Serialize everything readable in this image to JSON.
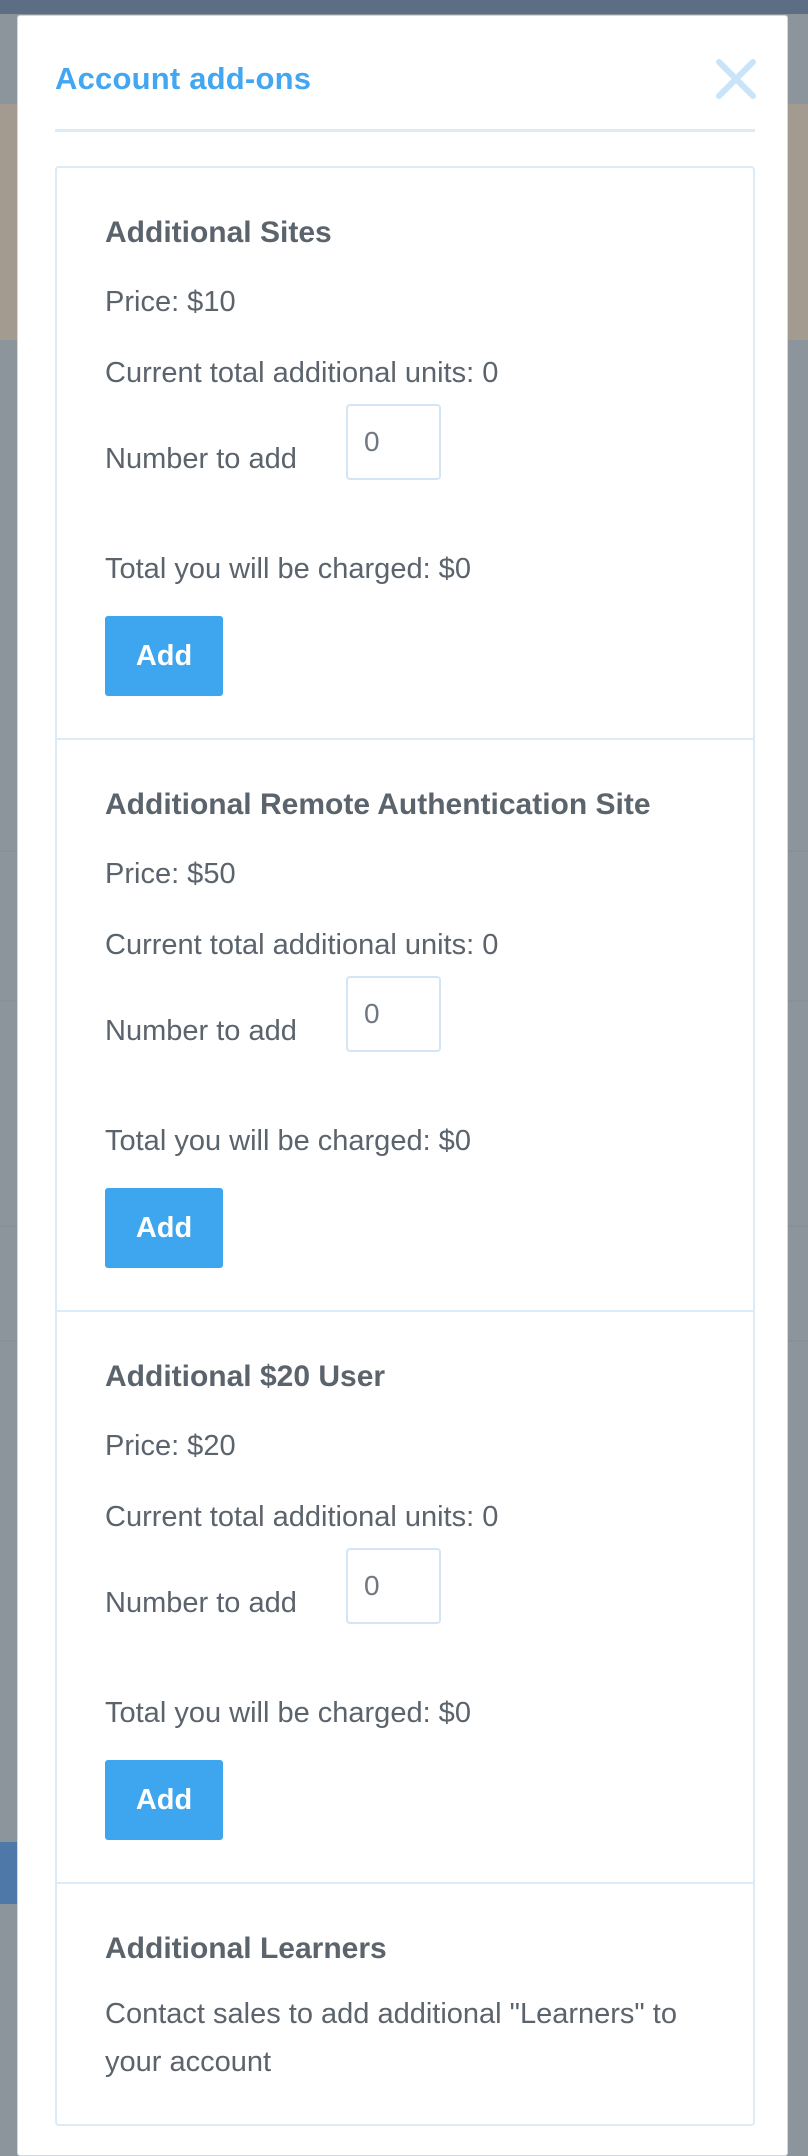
{
  "modal": {
    "title": "Account add-ons"
  },
  "labels": {
    "price_prefix": "Price: ",
    "units_prefix": "Current total additional units: ",
    "number_to_add": "Number to add",
    "charged_prefix": "Total you will be charged: ",
    "add_button": "Add"
  },
  "addons": [
    {
      "title": "Additional Sites",
      "price": "Price: $10",
      "units": "Current total additional units: 0",
      "number_label": "Number to add",
      "input_value": "0",
      "charged": "Total you will be charged: $0",
      "button": "Add"
    },
    {
      "title": "Additional Remote Authentication Site",
      "price": "Price: $50",
      "units": "Current total additional units: 0",
      "number_label": "Number to add",
      "input_value": "0",
      "charged": "Total you will be charged: $0",
      "button": "Add"
    },
    {
      "title": "Additional $20 User",
      "price": "Price: $20",
      "units": "Current total additional units: 0",
      "number_label": "Number to add",
      "input_value": "0",
      "charged": "Total you will be charged: $0",
      "button": "Add"
    },
    {
      "title": "Additional Learners",
      "note": "Contact sales to add additional \"Learners\" to your account"
    }
  ],
  "colors": {
    "accent": "#3da6ef",
    "title": "#42a7f0",
    "text": "#5b636c",
    "border": "#dcebf8"
  },
  "icons": {
    "close": "close-icon"
  }
}
